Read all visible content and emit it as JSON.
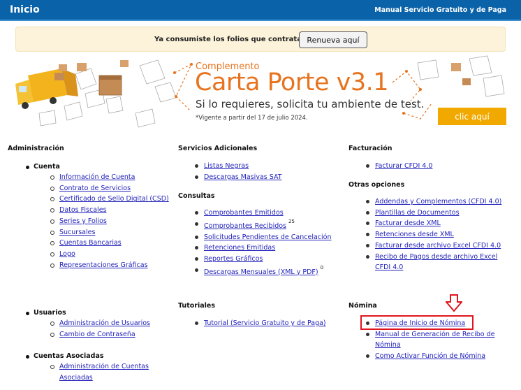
{
  "header": {
    "title": "Inicio",
    "manual_link": "Manual Servicio Gratuito y de Paga"
  },
  "alert": {
    "message": "Ya consumiste los folios que contrataste.",
    "button": "Renueva aquí"
  },
  "banner": {
    "subtitle": "Complemento",
    "title": "Carta Porte v3.1",
    "tagline": "Si lo requieres, solicita tu ambiente de test.",
    "note": "*Vigente a partir del 17 de julio 2024.",
    "cta": "clic aquí"
  },
  "administracion": {
    "heading": "Administración",
    "cuenta": {
      "label": "Cuenta",
      "items": [
        "Información de Cuenta",
        "Contrato de Servicios",
        "Certificado de Sello Digital (CSD)",
        "Datos Fiscales",
        "Series y Folios",
        "Sucursales",
        "Cuentas Bancarias",
        "Logo",
        "Representaciones Gráficas"
      ]
    },
    "usuarios": {
      "label": "Usuarios",
      "items": [
        "Administración de Usuarios",
        "Cambio de Contraseña"
      ]
    },
    "cuentas_asociadas": {
      "label": "Cuentas Asociadas",
      "items": [
        "Administración de Cuentas Asociadas"
      ]
    }
  },
  "servicios": {
    "heading": "Servicios Adicionales",
    "items": [
      "Listas Negras",
      "Descargas Masivas SAT"
    ],
    "consultas": {
      "heading": "Consultas",
      "items": [
        "Comprobantes Emitidos",
        "Comprobantes Recibidos",
        "Solicitudes Pendientes de Cancelación",
        "Retenciones Emitidas",
        "Reportes Gráficos",
        "Descargas Mensuales (XML y PDF)"
      ],
      "recibidos_badge": "25",
      "descargas_badge": "0"
    },
    "tutoriales": {
      "heading": "Tutoriales",
      "items": [
        "Tutorial (Servicio Gratuito y de Paga)"
      ]
    }
  },
  "facturacion": {
    "heading": "Facturación",
    "items": [
      "Facturar CFDI 4.0"
    ],
    "otras": {
      "heading": "Otras opciones",
      "items": [
        "Addendas y Complementos (CFDI 4.0)",
        "Plantillas de Documentos",
        "Facturar desde XML",
        "Retenciones desde XML",
        "Facturar desde archivo Excel CFDI 4.0",
        "Recibo de Pagos desde archivo Excel CFDI 4.0"
      ]
    },
    "nomina": {
      "heading": "Nómina",
      "items": [
        "Página de Inicio de Nómina",
        "Manual de Generación de Recibo de Nómina",
        "Como Activar Función de Nómina"
      ]
    }
  },
  "colors": {
    "header_bg": "#0a62a9",
    "banner_orange": "#e8731e",
    "cta_bg": "#f1a900",
    "highlight": "#e0151d",
    "link": "#2222bb"
  }
}
